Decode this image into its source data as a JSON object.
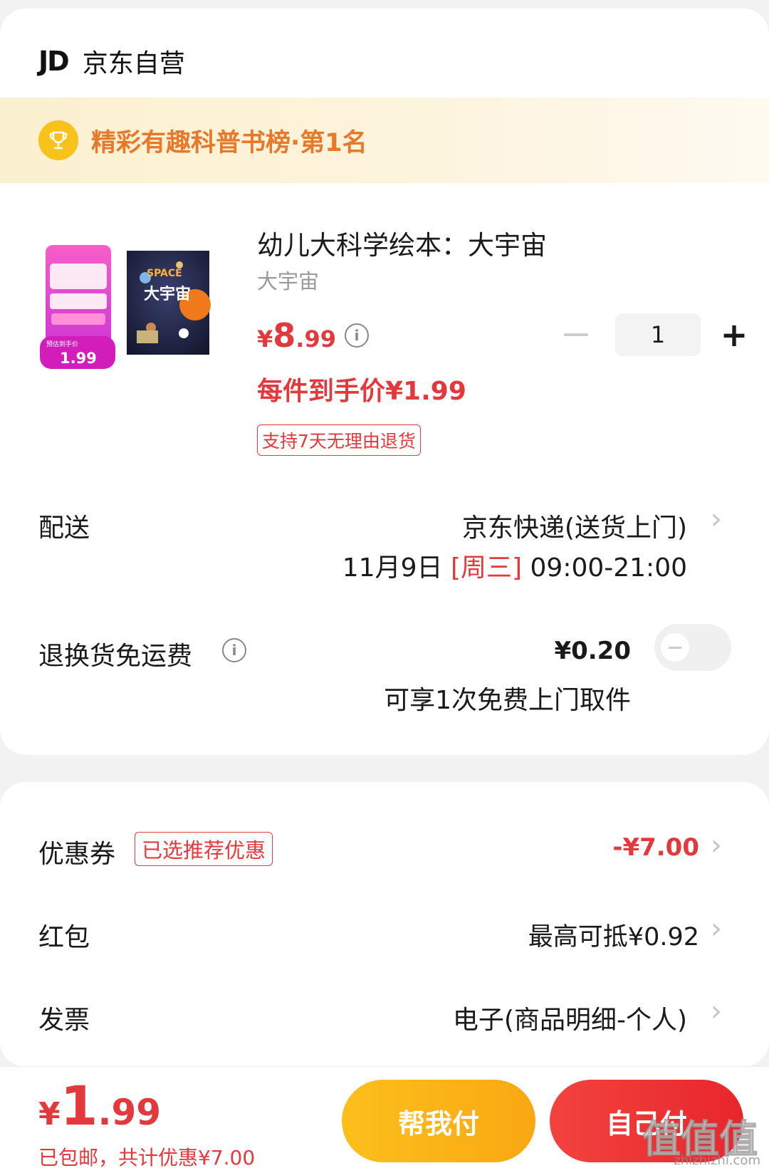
{
  "store": {
    "logo_text": "JD",
    "name": "京东自营"
  },
  "rank_banner": {
    "text": "精彩有趣科普书榜·第1名"
  },
  "product": {
    "title": "幼儿大科学绘本：大宇宙",
    "subtitle": "大宇宙",
    "price_yen": "¥",
    "price_int": "8",
    "price_dec": ".99",
    "quantity": "1",
    "per_item_price": "每件到手价¥1.99",
    "return_tag": "支持7天无理由退货",
    "image_overlay": {
      "tag_label": "预估到手价",
      "tag_price": "1.99",
      "cover_title_en": "SPACE",
      "cover_title_cn": "大宇宙"
    }
  },
  "delivery": {
    "label": "配送",
    "method": "京东快递(送货上门)",
    "date": "11月9日",
    "weekday": "[周三]",
    "time": "09:00-21:00"
  },
  "return_shipping": {
    "label": "退换货免运费",
    "price": "¥0.20",
    "note": "可享1次免费上门取件",
    "enabled": false
  },
  "coupon": {
    "label": "优惠券",
    "tag": "已选推荐优惠",
    "value": "-¥7.00"
  },
  "red_packet": {
    "label": "红包",
    "value": "最高可抵¥0.92"
  },
  "invoice": {
    "label": "发票",
    "value": "电子(商品明细-个人)"
  },
  "footer": {
    "total_yen": "¥",
    "total_int": "1",
    "total_dec": ".99",
    "total_note": "已包邮，共计优惠¥7.00",
    "help_pay_label": "帮我付",
    "self_pay_label": "自己付"
  },
  "watermark": {
    "text": "值值值",
    "url": "zhizhizhi.com"
  },
  "colors": {
    "accent_red": "#e4393c",
    "banner_orange": "#e8782a",
    "help_btn": "#fdbf1c",
    "self_btn": "#f2433f"
  }
}
